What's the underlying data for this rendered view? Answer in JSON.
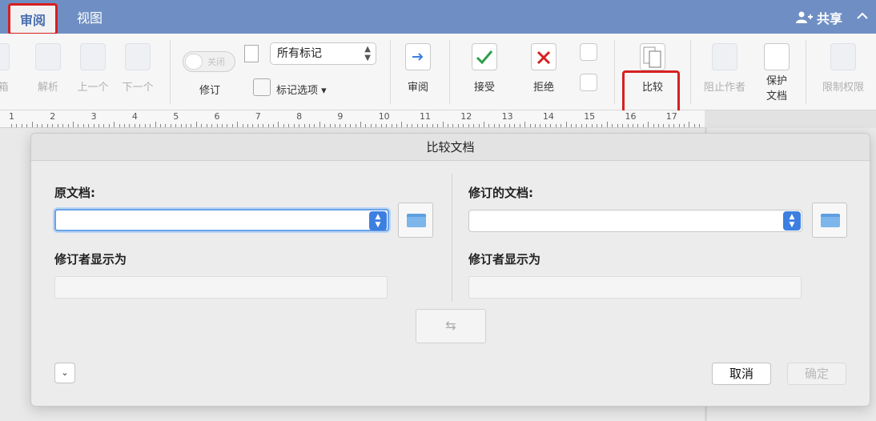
{
  "tabs": {
    "review": "审阅",
    "view": "视图"
  },
  "share_label": "共享",
  "ribbon": {
    "partial_left": "箱",
    "parse": "解析",
    "prev": "上一个",
    "next": "下一个",
    "track": "修订",
    "toggle_off": "关闭",
    "markup_select": "所有标记",
    "markup_options": "标记选项",
    "review_pane": "审阅",
    "accept": "接受",
    "reject": "拒绝",
    "compare": "比较",
    "block_authors": "阻止作者",
    "protect_line1": "保护",
    "protect_line2": "文档",
    "restrict": "限制权限"
  },
  "ruler_numbers": [
    "1",
    "2",
    "3",
    "4",
    "5",
    "6",
    "7",
    "8",
    "9",
    "10",
    "11",
    "12",
    "13",
    "14",
    "15",
    "16",
    "17"
  ],
  "dialog": {
    "title": "比较文档",
    "original_label": "原文档:",
    "revised_label": "修订的文档:",
    "original_author_label": "修订者显示为",
    "revised_author_label": "修订者显示为",
    "original_value": "",
    "revised_value": "",
    "original_author_value": "",
    "revised_author_value": "",
    "swap_glyph": "⇆",
    "expand_glyph": "⌄",
    "cancel": "取消",
    "ok": "确定"
  },
  "colors": {
    "tabbar": "#6f8fc4",
    "highlight": "#d62020",
    "accent": "#3d7fe0"
  }
}
